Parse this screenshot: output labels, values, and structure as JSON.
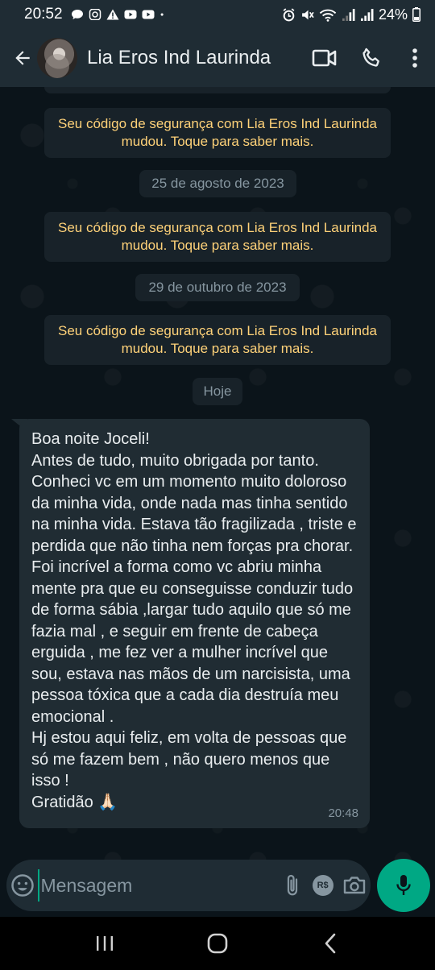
{
  "status_bar": {
    "time": "20:52",
    "battery": "24%"
  },
  "header": {
    "title": "Lia Eros Ind Laurinda"
  },
  "chat": {
    "system_messages": [
      "Seu código de segurança com Lia Eros Ind Laurinda mudou. Toque para saber mais.",
      "Seu código de segurança com Lia Eros Ind Laurinda mudou. Toque para saber mais.",
      "Seu código de segurança com Lia Eros Ind Laurinda mudou. Toque para saber mais."
    ],
    "dates": [
      "25 de agosto de 2023",
      "29 de outubro de 2023",
      "Hoje"
    ],
    "message": {
      "text": "Boa noite Joceli!\nAntes de tudo, muito obrigada por tanto.\nConheci vc em um momento muito doloroso da minha vida, onde nada mas tinha sentido na minha vida. Estava tão fragilizada , triste  e perdida que não tinha nem  forças  pra chorar.\nFoi incrível a forma como vc abriu minha mente pra que eu conseguisse  conduzir tudo de forma sábia ,largar  tudo aquilo que só me fazia mal , e seguir em frente de cabeça erguida , me fez ver a mulher incrível que sou, estava nas mãos de um narcisista, uma pessoa tóxica que a cada dia destruía meu emocional .\nHj estou aqui feliz, em volta de pessoas que só me fazem bem , não quero menos que isso !\nGratidão 🙏🏻",
      "time": "20:48"
    }
  },
  "composer": {
    "placeholder": "Mensagem",
    "payment_label": "R$"
  },
  "colors": {
    "accent": "#00a884",
    "system_text": "#ffd279",
    "bubble": "#202c33",
    "background": "#0b141a"
  }
}
